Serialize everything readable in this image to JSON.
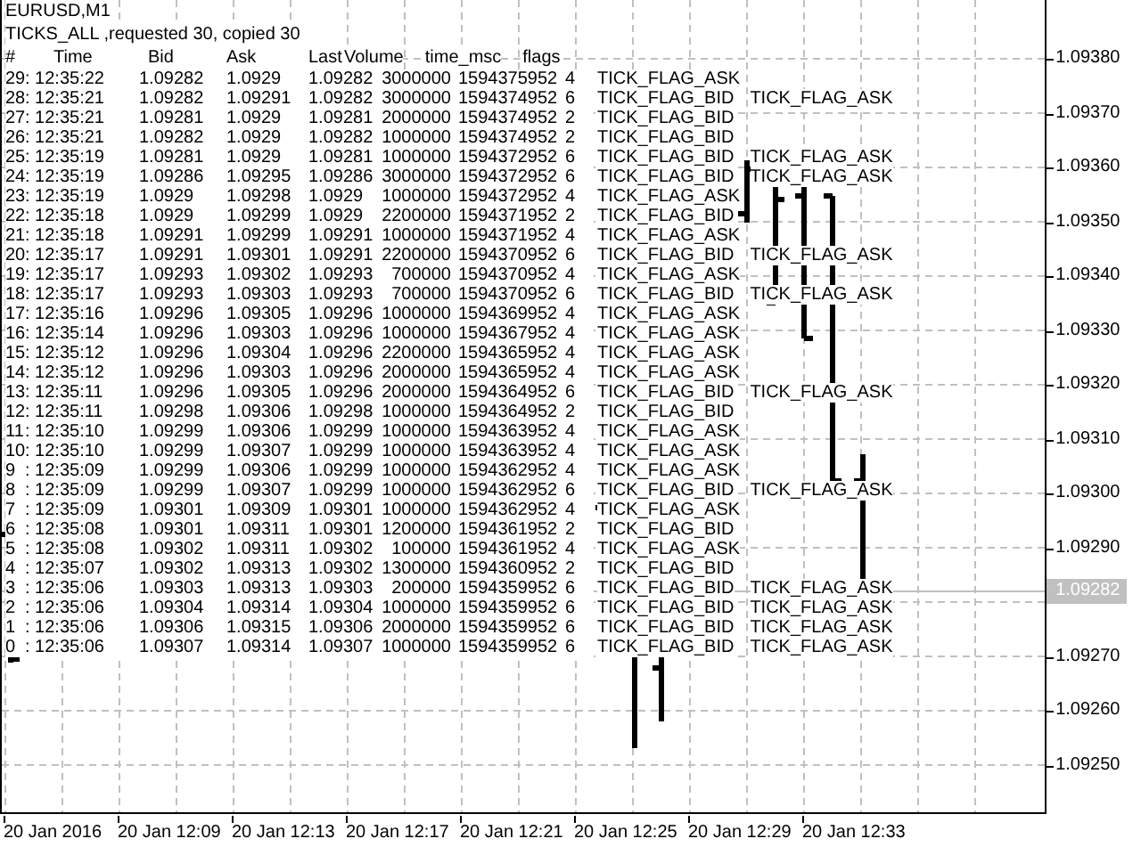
{
  "chart": {
    "symbol": "EURUSD,M1",
    "summary": "TICKS_ALL ,requested 30, copied 30",
    "columns": [
      "#",
      "Time",
      "Bid",
      "Ask",
      "Last",
      "Volume",
      "time_msc",
      "flags"
    ],
    "ticks": [
      {
        "n": "29",
        "time": ": 12:35:22",
        "bid": "1.09282",
        "ask": "1.0929",
        "last": "1.09282",
        "volume": "3000000",
        "time_msc": "1594375952",
        "flags": "4",
        "flag_names": [
          "TICK_FLAG_ASK"
        ]
      },
      {
        "n": "28",
        "time": ": 12:35:21",
        "bid": "1.09282",
        "ask": "1.09291",
        "last": "1.09282",
        "volume": "3000000",
        "time_msc": "1594374952",
        "flags": "6",
        "flag_names": [
          "TICK_FLAG_BID",
          "TICK_FLAG_ASK"
        ]
      },
      {
        "n": "27",
        "time": ": 12:35:21",
        "bid": "1.09281",
        "ask": "1.0929",
        "last": "1.09281",
        "volume": "2000000",
        "time_msc": "1594374952",
        "flags": "2",
        "flag_names": [
          "TICK_FLAG_BID"
        ]
      },
      {
        "n": "26",
        "time": ": 12:35:21",
        "bid": "1.09282",
        "ask": "1.0929",
        "last": "1.09282",
        "volume": "1000000",
        "time_msc": "1594374952",
        "flags": "2",
        "flag_names": [
          "TICK_FLAG_BID"
        ]
      },
      {
        "n": "25",
        "time": ": 12:35:19",
        "bid": "1.09281",
        "ask": "1.0929",
        "last": "1.09281",
        "volume": "1000000",
        "time_msc": "1594372952",
        "flags": "6",
        "flag_names": [
          "TICK_FLAG_BID",
          "TICK_FLAG_ASK"
        ]
      },
      {
        "n": "24",
        "time": ": 12:35:19",
        "bid": "1.09286",
        "ask": "1.09295",
        "last": "1.09286",
        "volume": "3000000",
        "time_msc": "1594372952",
        "flags": "6",
        "flag_names": [
          "TICK_FLAG_BID",
          "TICK_FLAG_ASK"
        ]
      },
      {
        "n": "23",
        "time": ": 12:35:19",
        "bid": "1.0929",
        "ask": "1.09298",
        "last": "1.0929",
        "volume": "1000000",
        "time_msc": "1594372952",
        "flags": "4",
        "flag_names": [
          "TICK_FLAG_ASK"
        ]
      },
      {
        "n": "22",
        "time": ": 12:35:18",
        "bid": "1.0929",
        "ask": "1.09299",
        "last": "1.0929",
        "volume": "2200000",
        "time_msc": "1594371952",
        "flags": "2",
        "flag_names": [
          "TICK_FLAG_BID"
        ]
      },
      {
        "n": "21",
        "time": ": 12:35:18",
        "bid": "1.09291",
        "ask": "1.09299",
        "last": "1.09291",
        "volume": "1000000",
        "time_msc": "1594371952",
        "flags": "4",
        "flag_names": [
          "TICK_FLAG_ASK"
        ]
      },
      {
        "n": "20",
        "time": ": 12:35:17",
        "bid": "1.09291",
        "ask": "1.09301",
        "last": "1.09291",
        "volume": "2200000",
        "time_msc": "1594370952",
        "flags": "6",
        "flag_names": [
          "TICK_FLAG_BID",
          "TICK_FLAG_ASK"
        ]
      },
      {
        "n": "19",
        "time": ": 12:35:17",
        "bid": "1.09293",
        "ask": "1.09302",
        "last": "1.09293",
        "volume": "700000",
        "time_msc": "1594370952",
        "flags": "4",
        "flag_names": [
          "TICK_FLAG_ASK"
        ]
      },
      {
        "n": "18",
        "time": ": 12:35:17",
        "bid": "1.09293",
        "ask": "1.09303",
        "last": "1.09293",
        "volume": "700000",
        "time_msc": "1594370952",
        "flags": "6",
        "flag_names": [
          "TICK_FLAG_BID",
          "TICK_FLAG_ASK"
        ]
      },
      {
        "n": "17",
        "time": ": 12:35:16",
        "bid": "1.09296",
        "ask": "1.09305",
        "last": "1.09296",
        "volume": "1000000",
        "time_msc": "1594369952",
        "flags": "4",
        "flag_names": [
          "TICK_FLAG_ASK"
        ]
      },
      {
        "n": "16",
        "time": ": 12:35:14",
        "bid": "1.09296",
        "ask": "1.09303",
        "last": "1.09296",
        "volume": "1000000",
        "time_msc": "1594367952",
        "flags": "4",
        "flag_names": [
          "TICK_FLAG_ASK"
        ]
      },
      {
        "n": "15",
        "time": ": 12:35:12",
        "bid": "1.09296",
        "ask": "1.09304",
        "last": "1.09296",
        "volume": "2200000",
        "time_msc": "1594365952",
        "flags": "4",
        "flag_names": [
          "TICK_FLAG_ASK"
        ]
      },
      {
        "n": "14",
        "time": ": 12:35:12",
        "bid": "1.09296",
        "ask": "1.09303",
        "last": "1.09296",
        "volume": "2000000",
        "time_msc": "1594365952",
        "flags": "4",
        "flag_names": [
          "TICK_FLAG_ASK"
        ]
      },
      {
        "n": "13",
        "time": ": 12:35:11",
        "bid": "1.09296",
        "ask": "1.09305",
        "last": "1.09296",
        "volume": "2000000",
        "time_msc": "1594364952",
        "flags": "6",
        "flag_names": [
          "TICK_FLAG_BID",
          "TICK_FLAG_ASK"
        ]
      },
      {
        "n": "12",
        "time": ": 12:35:11",
        "bid": "1.09298",
        "ask": "1.09306",
        "last": "1.09298",
        "volume": "1000000",
        "time_msc": "1594364952",
        "flags": "2",
        "flag_names": [
          "TICK_FLAG_BID"
        ]
      },
      {
        "n": "11",
        "time": ": 12:35:10",
        "bid": "1.09299",
        "ask": "1.09306",
        "last": "1.09299",
        "volume": "1000000",
        "time_msc": "1594363952",
        "flags": "4",
        "flag_names": [
          "TICK_FLAG_ASK"
        ]
      },
      {
        "n": "10",
        "time": ": 12:35:10",
        "bid": "1.09299",
        "ask": "1.09307",
        "last": "1.09299",
        "volume": "1000000",
        "time_msc": "1594363952",
        "flags": "4",
        "flag_names": [
          "TICK_FLAG_ASK"
        ]
      },
      {
        "n": "9",
        "time": ": 12:35:09",
        "bid": "1.09299",
        "ask": "1.09306",
        "last": "1.09299",
        "volume": "1000000",
        "time_msc": "1594362952",
        "flags": "4",
        "flag_names": [
          "TICK_FLAG_ASK"
        ]
      },
      {
        "n": "8",
        "time": ": 12:35:09",
        "bid": "1.09299",
        "ask": "1.09307",
        "last": "1.09299",
        "volume": "1000000",
        "time_msc": "1594362952",
        "flags": "6",
        "flag_names": [
          "TICK_FLAG_BID",
          "TICK_FLAG_ASK"
        ]
      },
      {
        "n": "7",
        "time": ": 12:35:09",
        "bid": "1.09301",
        "ask": "1.09309",
        "last": "1.09301",
        "volume": "1000000",
        "time_msc": "1594362952",
        "flags": "4",
        "flag_names": [
          "TICK_FLAG_ASK"
        ]
      },
      {
        "n": "6",
        "time": ": 12:35:08",
        "bid": "1.09301",
        "ask": "1.09311",
        "last": "1.09301",
        "volume": "1200000",
        "time_msc": "1594361952",
        "flags": "2",
        "flag_names": [
          "TICK_FLAG_BID"
        ]
      },
      {
        "n": "5",
        "time": ": 12:35:08",
        "bid": "1.09302",
        "ask": "1.09311",
        "last": "1.09302",
        "volume": "100000",
        "time_msc": "1594361952",
        "flags": "4",
        "flag_names": [
          "TICK_FLAG_ASK"
        ]
      },
      {
        "n": "4",
        "time": ": 12:35:07",
        "bid": "1.09302",
        "ask": "1.09313",
        "last": "1.09302",
        "volume": "1300000",
        "time_msc": "1594360952",
        "flags": "2",
        "flag_names": [
          "TICK_FLAG_BID"
        ]
      },
      {
        "n": "3",
        "time": ": 12:35:06",
        "bid": "1.09303",
        "ask": "1.09313",
        "last": "1.09303",
        "volume": "200000",
        "time_msc": "1594359952",
        "flags": "6",
        "flag_names": [
          "TICK_FLAG_BID",
          "TICK_FLAG_ASK"
        ]
      },
      {
        "n": "2",
        "time": ": 12:35:06",
        "bid": "1.09304",
        "ask": "1.09314",
        "last": "1.09304",
        "volume": "1000000",
        "time_msc": "1594359952",
        "flags": "6",
        "flag_names": [
          "TICK_FLAG_BID",
          "TICK_FLAG_ASK"
        ]
      },
      {
        "n": "1",
        "time": ": 12:35:06",
        "bid": "1.09306",
        "ask": "1.09315",
        "last": "1.09306",
        "volume": "2000000",
        "time_msc": "1594359952",
        "flags": "6",
        "flag_names": [
          "TICK_FLAG_BID",
          "TICK_FLAG_ASK"
        ]
      },
      {
        "n": "0",
        "time": ": 12:35:06",
        "bid": "1.09307",
        "ask": "1.09314",
        "last": "1.09307",
        "volume": "1000000",
        "time_msc": "1594359952",
        "flags": "6",
        "flag_names": [
          "TICK_FLAG_BID",
          "TICK_FLAG_ASK"
        ]
      }
    ],
    "price_axis": [
      {
        "label": "1.09380",
        "kind": "tick"
      },
      {
        "label": "1.09370",
        "kind": "tick"
      },
      {
        "label": "1.09360",
        "kind": "tick"
      },
      {
        "label": "1.09350",
        "kind": "tick"
      },
      {
        "label": "1.09340",
        "kind": "tick"
      },
      {
        "label": "1.09330",
        "kind": "tick"
      },
      {
        "label": "1.09320",
        "kind": "tick"
      },
      {
        "label": "1.09310",
        "kind": "tick"
      },
      {
        "label": "1.09300",
        "kind": "tick"
      },
      {
        "label": "1.09290",
        "kind": "tick"
      },
      {
        "label": "1.09282",
        "kind": "current"
      },
      {
        "label": "1.09270",
        "kind": "tick"
      },
      {
        "label": "1.09260",
        "kind": "tick"
      },
      {
        "label": "1.09250",
        "kind": "tick"
      }
    ],
    "time_axis": [
      "20 Jan 2016",
      "20 Jan 12:09",
      "20 Jan 12:13",
      "20 Jan 12:17",
      "20 Jan 12:21",
      "20 Jan 12:25",
      "20 Jan 12:29",
      "20 Jan 12:33"
    ]
  }
}
